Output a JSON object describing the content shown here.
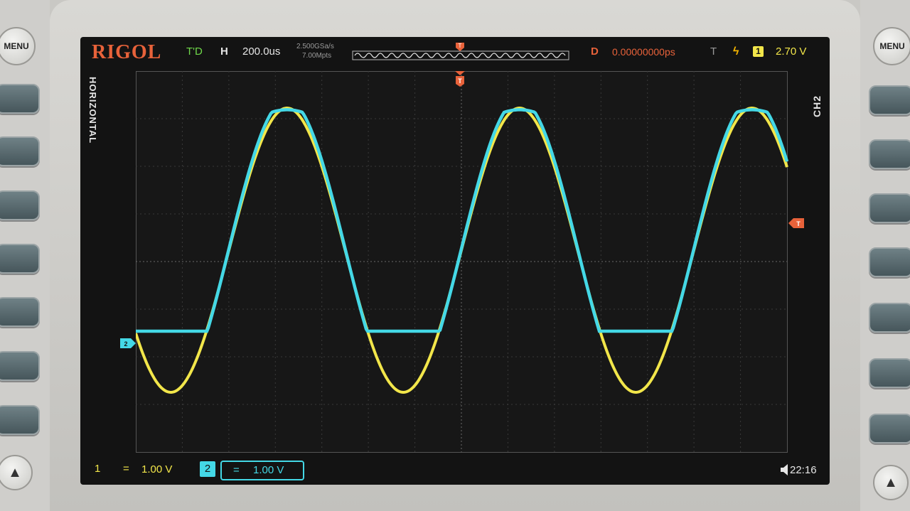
{
  "panel": {
    "menu_label_left": "MENU",
    "menu_label_right": "MENU"
  },
  "header": {
    "brand": "RIGOL",
    "run_status": "T'D",
    "horizontal_label": "H",
    "timebase": "200.0us",
    "sample_rate": "2.500GSa/s",
    "memory_depth": "7.00Mpts",
    "trigger_flag": "T",
    "delay_label": "D",
    "delay_value": "0.00000000ps",
    "trigger_label": "T",
    "trigger_source": "1",
    "trigger_level": "2.70 V"
  },
  "side": {
    "left_vertical_label": "HORIZONTAL",
    "right_vertical_label": "CH2"
  },
  "markers": {
    "ch2_ground": "2",
    "trigger_level_marker": "T",
    "trigger_position_marker": "T"
  },
  "footer": {
    "ch1_number": "1",
    "ch1_coupling": "=",
    "ch1_scale": "1.00 V",
    "ch2_number": "2",
    "ch2_coupling": "=",
    "ch2_scale": "1.00 V",
    "speaker_icon": "speaker-icon",
    "clock": "22:16"
  },
  "colors": {
    "ch1": "#f2e64a",
    "ch2": "#44d8e6",
    "accent": "#e8623a",
    "trigger": "#f4b400"
  }
}
